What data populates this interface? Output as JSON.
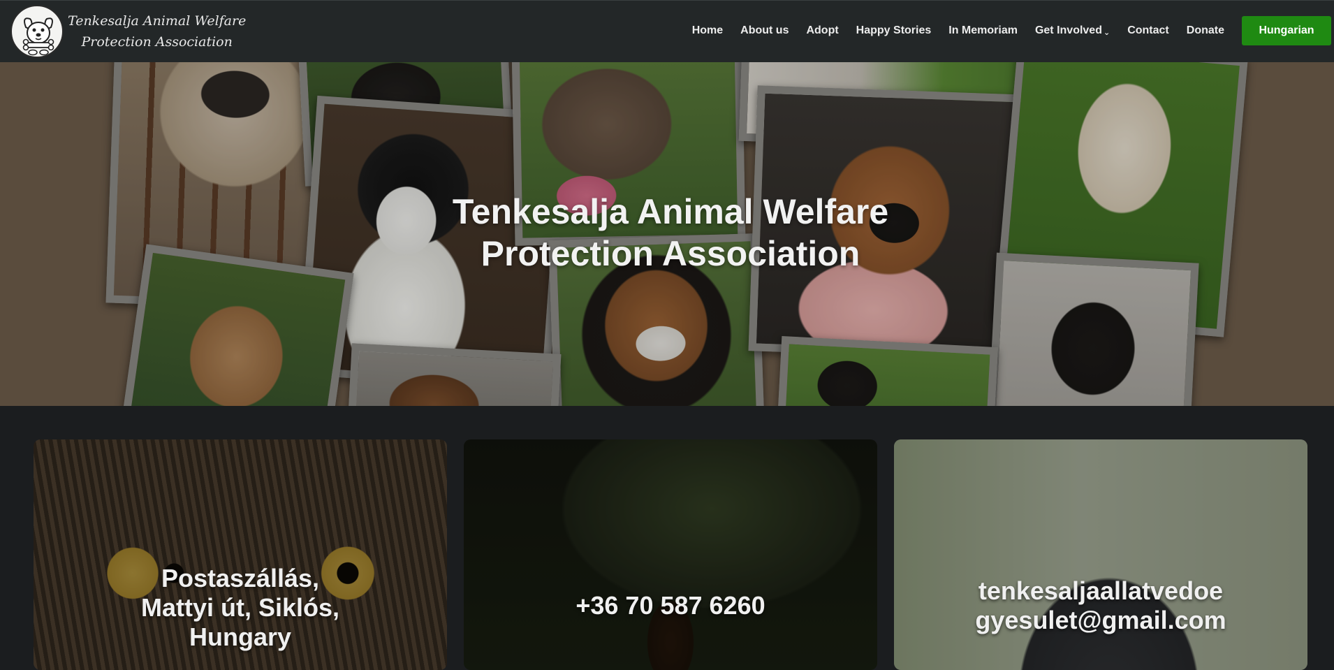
{
  "brand": {
    "name_line1": "Tenkesalja Animal Welfare",
    "name_line2": "Protection Association",
    "logo_icon": "cartoon-dog-with-bone-icon"
  },
  "nav": {
    "items": [
      {
        "label": "Home"
      },
      {
        "label": "About us"
      },
      {
        "label": "Adopt"
      },
      {
        "label": "Happy Stories"
      },
      {
        "label": "In Memoriam"
      },
      {
        "label": "Get Involved",
        "has_dropdown": true
      },
      {
        "label": "Contact"
      },
      {
        "label": "Donate"
      }
    ],
    "language_button": "Hungarian",
    "language_button_color": "#1f8a12"
  },
  "hero": {
    "title_line1": "Tenkesalja Animal Welfare",
    "title_line2": "Protection Association",
    "background_color": "#6e5d4b"
  },
  "cards": [
    {
      "lines": [
        "Postaszállás,",
        "Mattyi út, Siklós,",
        "Hungary"
      ],
      "image": "cat-eyes-closeup"
    },
    {
      "lines": [
        "+36 70 587 6260"
      ],
      "image": "small-dog-running"
    },
    {
      "lines": [
        "tenkesaljaallatvedoe",
        "gyesulet@gmail.com"
      ],
      "image": "grey-cat"
    }
  ],
  "colors": {
    "navbar_bg": "#232728",
    "page_bg": "#1b1d1f"
  }
}
